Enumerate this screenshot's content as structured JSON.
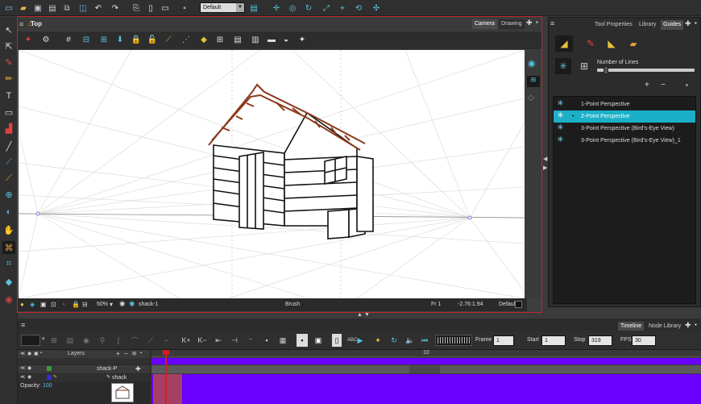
{
  "toolbar": {
    "layout_preset": "Default",
    "icons": [
      "new-icon",
      "open-icon",
      "save-icon",
      "save-as-icon",
      "import-icon",
      "undo-icon",
      "redo-icon",
      "copy-icon",
      "paste-icon",
      "clipboard-icon",
      "workspace-icon",
      "layout-dropdown",
      "camera-icon",
      "onion-skin-icon",
      "rotate-icon",
      "transform-icon",
      "snap-icon",
      "settings-icon"
    ]
  },
  "camera_view": {
    "title": "Top",
    "tabs": [
      "Camera",
      "Drawing"
    ],
    "status": {
      "zoom": "50%",
      "layer": "shack-1",
      "tool": "Brush",
      "frame": "Fr 1",
      "coords": "-2.76:1.94",
      "palette": "Default"
    }
  },
  "right_panel": {
    "tabs": [
      "Tool Properties",
      "Library",
      "Guides"
    ],
    "active_tab": "Guides",
    "number_of_lines_label": "Number of Lines",
    "guides": [
      {
        "label": "1-Point Perspective",
        "selected": false
      },
      {
        "label": "2-Point Perspective",
        "selected": true
      },
      {
        "label": "3-Point Perspective (Bird's-Eye View)",
        "selected": false
      },
      {
        "label": "3-Point Perspective (Bird's-Eye View)_1",
        "selected": false
      }
    ]
  },
  "timeline": {
    "tabs": [
      "Timeline",
      "Node Library"
    ],
    "active_tab": "Timeline",
    "frame_label": "Frame",
    "frame_value": "1",
    "start_label": "Start",
    "start_value": "1",
    "stop_label": "Stop",
    "stop_value": "319",
    "fps_label": "FPS",
    "fps_value": "30",
    "ruler_mark": "10",
    "layers_header": "Layers",
    "layers": [
      "shack-P",
      "shack"
    ],
    "opacity_label": "Opacity:",
    "opacity_value": "100"
  },
  "colors": {
    "accent": "#1bb0c8",
    "frame_border": "#c0262b",
    "track_purple": "#6a00ff",
    "playhead": "#d01f1f"
  }
}
